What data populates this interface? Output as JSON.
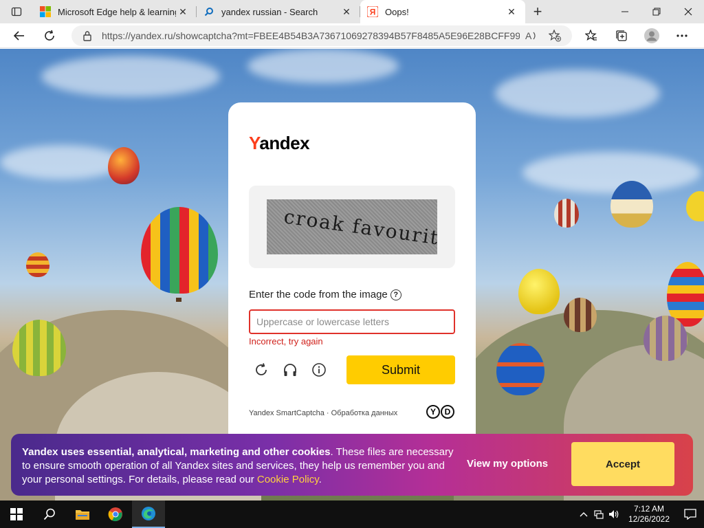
{
  "browser": {
    "tabs": [
      {
        "title": "Microsoft Edge help & learning",
        "favicon": "microsoft-logo-icon",
        "active": false
      },
      {
        "title": "yandex russian - Search",
        "favicon": "search-icon",
        "active": false
      },
      {
        "title": "Oops!",
        "favicon": "yandex-favicon-icon",
        "active": true
      }
    ],
    "url": "https://yandex.ru/showcaptcha?mt=FBEE4B54B3A73671069278394B57F8485A5E96E28BCFF99E8..."
  },
  "captcha": {
    "logo_first": "Y",
    "logo_rest": "andex",
    "captcha_text": "croak favourite",
    "prompt": "Enter the code from the image",
    "help_glyph": "?",
    "input_placeholder": "Uppercase or lowercase letters",
    "input_value": "",
    "error": "Incorrect, try again",
    "submit_label": "Submit",
    "footer": "Yandex SmartCaptcha · Обработка данных",
    "brand_badge": [
      "Y",
      "D"
    ]
  },
  "cookie_banner": {
    "bold_text": "Yandex uses essential, analytical, marketing and other cookies",
    "text": ". These files are necessary to ensure smooth operation of all Yandex sites and services, they help us remember you and your personal settings. For details, please read our ",
    "link_text": "Cookie Policy",
    "tail": ".",
    "view_options_label": "View my options",
    "accept_label": "Accept"
  },
  "taskbar": {
    "time": "7:12 AM",
    "date": "12/26/2022"
  },
  "colors": {
    "yandex_red": "#fc3f1d",
    "submit_yellow": "#ffcc00",
    "error_red": "#e0312a",
    "accept_yellow": "#ffdc60",
    "cookie_link": "#ffd23f"
  }
}
